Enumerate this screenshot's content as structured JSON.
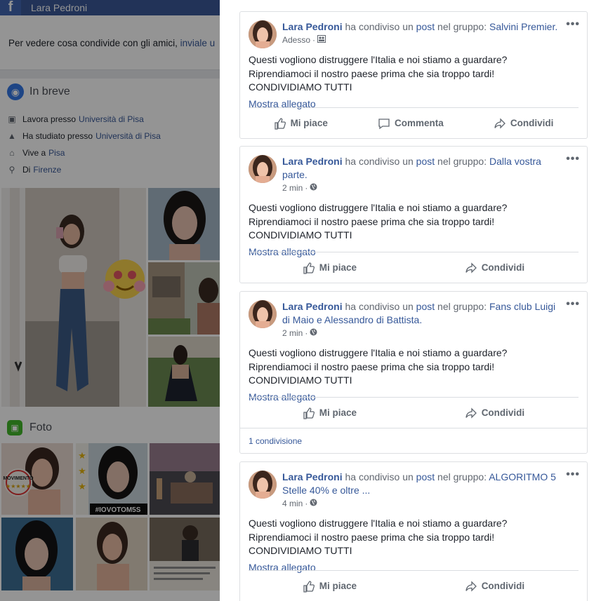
{
  "profile": {
    "name": "Lara Pedroni",
    "notice_text": "Per vedere cosa condivide con gli amici,",
    "notice_link": "inviale u",
    "intro_title": "In breve",
    "intro": [
      {
        "icon": "briefcase-icon",
        "text": "Lavora presso",
        "link": "Università di Pisa"
      },
      {
        "icon": "graduation-cap-icon",
        "text": "Ha studiato presso",
        "link": "Università di Pisa"
      },
      {
        "icon": "home-icon",
        "text": "Vive a",
        "link": "Pisa"
      },
      {
        "icon": "location-pin-icon",
        "text": "Di",
        "link": "Firenze"
      }
    ],
    "photos_title": "Foto",
    "photo_overlay_texts": [
      "MOVIMENTO",
      "#IOVOTOM5S"
    ]
  },
  "posts": [
    {
      "author": "Lara Pedroni",
      "shared_text": "ha condiviso un",
      "post_word": "post",
      "in_group_text": "nel gruppo:",
      "group": "Salvini Premier.",
      "time": "Adesso",
      "privacy_icon": "group-icon",
      "body": [
        "Questi vogliono distruggere l'Italia e noi stiamo a guardare?",
        "Riprendiamoci il nostro paese prima che sia troppo tardi!",
        "CONDIVIDIAMO TUTTI"
      ],
      "show_attachment": "Mostra allegato",
      "actions": [
        "Mi piace",
        "Commenta",
        "Condividi"
      ],
      "shares": ""
    },
    {
      "author": "Lara Pedroni",
      "shared_text": "ha condiviso un",
      "post_word": "post",
      "in_group_text": "nel gruppo:",
      "group": "Dalla vostra parte.",
      "time": "2 min",
      "privacy_icon": "globe-icon",
      "body": [
        "Questi vogliono distruggere l'Italia e noi stiamo a guardare?",
        "Riprendiamoci il nostro paese prima che sia troppo tardi!",
        "CONDIVIDIAMO TUTTI"
      ],
      "show_attachment": "Mostra allegato",
      "actions": [
        "Mi piace",
        "Condividi"
      ],
      "shares": ""
    },
    {
      "author": "Lara Pedroni",
      "shared_text": "ha condiviso un",
      "post_word": "post",
      "in_group_text": "nel gruppo:",
      "group": "Fans club Luigi di Maio e Alessandro di Battista.",
      "time": "2 min",
      "privacy_icon": "globe-icon",
      "body": [
        "Questi vogliono distruggere l'Italia e noi stiamo a guardare?",
        "Riprendiamoci il nostro paese prima che sia troppo tardi!",
        "CONDIVIDIAMO TUTTI"
      ],
      "show_attachment": "Mostra allegato",
      "actions": [
        "Mi piace",
        "Condividi"
      ],
      "shares": "1 condivisione"
    },
    {
      "author": "Lara Pedroni",
      "shared_text": "ha condiviso un",
      "post_word": "post",
      "in_group_text": "nel gruppo:",
      "group": "ALGORITMO 5 Stelle 40% e oltre ...",
      "time": "4 min",
      "privacy_icon": "globe-icon",
      "body": [
        "Questi vogliono distruggere l'Italia e noi stiamo a guardare?",
        "Riprendiamoci il nostro paese prima che sia troppo tardi!",
        "CONDIVIDIAMO TUTTI"
      ],
      "show_attachment": "Mostra allegato",
      "actions": [
        "Mi piace",
        "Condividi"
      ],
      "shares": ""
    }
  ],
  "colors": {
    "facebook_blue": "#3b5998",
    "link": "#365899",
    "muted": "#616770",
    "border": "#dddfe2"
  }
}
